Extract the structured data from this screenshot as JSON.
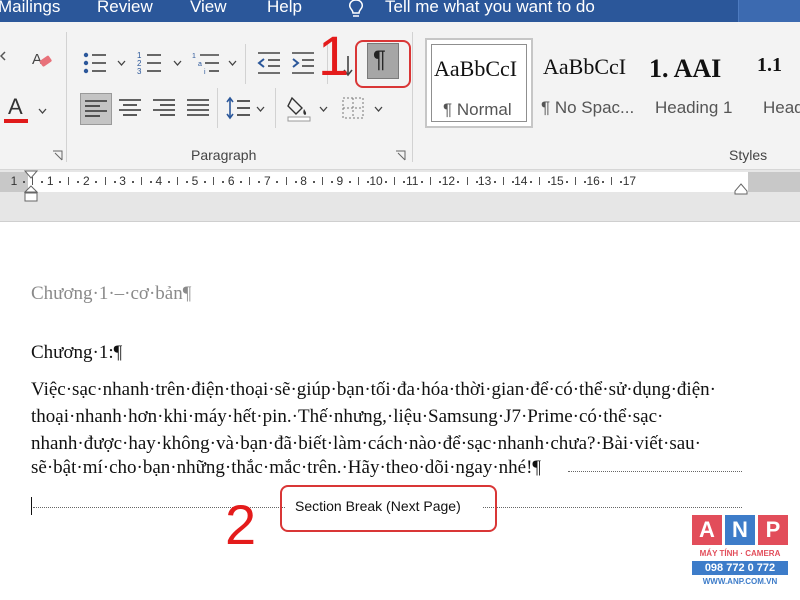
{
  "tabs": [
    "Mailings",
    "Review",
    "View",
    "Help"
  ],
  "tell_me": "Tell me what you want to do",
  "ribbon": {
    "paragraph_label": "Paragraph",
    "styles_label": "Styles",
    "pilcrow": "¶",
    "font_color_letter": "A"
  },
  "styles": [
    {
      "preview": "AaBbCcI",
      "name": "¶ Normal"
    },
    {
      "preview": "AaBbCcI",
      "name": "¶ No Spac..."
    },
    {
      "preview": "1. AAI",
      "name": "Heading 1"
    },
    {
      "preview": "1.1",
      "name": "Head"
    }
  ],
  "ruler": {
    "numbers": [
      "1",
      "1",
      "2",
      "3",
      "4",
      "5",
      "6",
      "7",
      "8",
      "9",
      "10",
      "11",
      "12",
      "13",
      "14",
      "15",
      "16",
      "17"
    ]
  },
  "document": {
    "title": "Chương·1·–·cơ·bản¶",
    "heading": "Chương·1:¶",
    "paragraph_lines": [
      "Việc·sạc·nhanh·trên·điện·thoại·sẽ·giúp·bạn·tối·đa·hóa·thời·gian·để·có·thể·sử·dụng·điện·",
      "thoại·nhanh·hơn·khi·máy·hết·pin.·Thế·nhưng,·liệu·Samsung·J7·Prime·có·thể·sạc·",
      "nhanh·được·hay·không·và·bạn·đã·biết·làm·cách·nào·để·sạc·nhanh·chưa?·Bài·viết·sau·",
      "sẽ·bật·mí·cho·bạn·những·thắc·mắc·trên.·Hãy·theo·dõi·ngay·nhé!¶"
    ],
    "section_break": "Section Break (Next Page)"
  },
  "annotations": {
    "one": "1",
    "two": "2"
  },
  "logo": {
    "letters": [
      "A",
      "N",
      "P"
    ],
    "tagline": "MÁY TÍNH · CAMERA",
    "phone": "098 772 0 772",
    "website": "WWW.ANP.COM.VN"
  },
  "colors": {
    "ribbon_blue": "#2b579a",
    "annotation_red": "#e41b1b",
    "logo_red": "#e24d5a",
    "logo_blue": "#3d7cc9"
  }
}
